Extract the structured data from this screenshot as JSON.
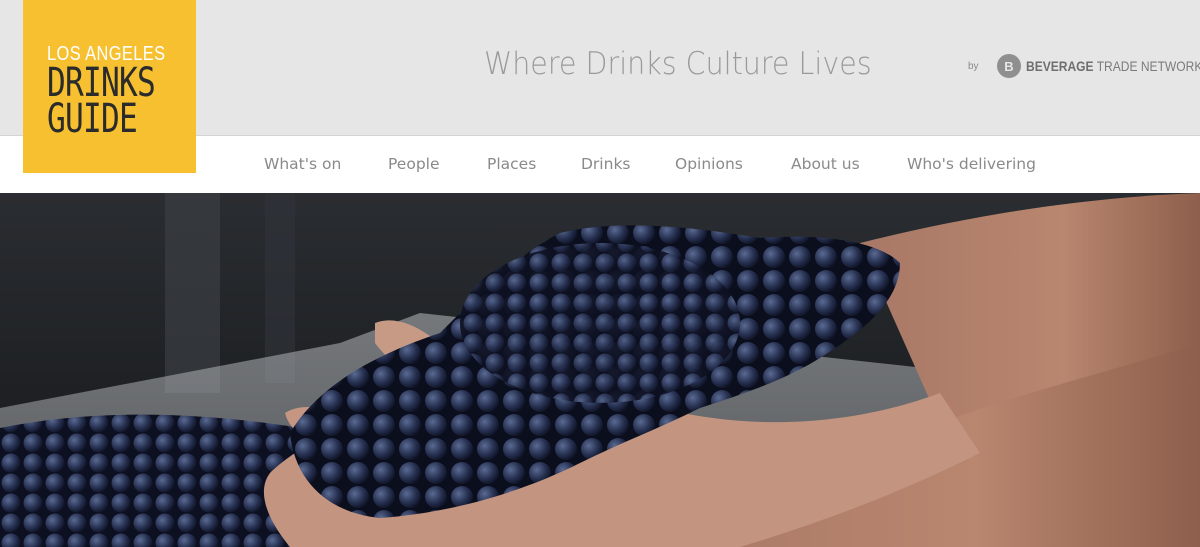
{
  "logo": {
    "line1": "LOS ANGELES",
    "line2": "DRINKS",
    "line3": "GUIDE",
    "color": "#f6c031"
  },
  "header": {
    "tagline": "Where Drinks Culture Lives",
    "by_label": "by",
    "partner_icon": "btn-shield-icon",
    "partner_bold": "BEVERAGE",
    "partner_rest": " TRADE NETWORK"
  },
  "nav": {
    "items": [
      "What's on",
      "People",
      "Places",
      "Drinks",
      "Opinions",
      "About us",
      "Who's delivering"
    ]
  },
  "hero": {
    "image": "hand holding a bunch of dark red wine grapes over a harvest bin"
  }
}
